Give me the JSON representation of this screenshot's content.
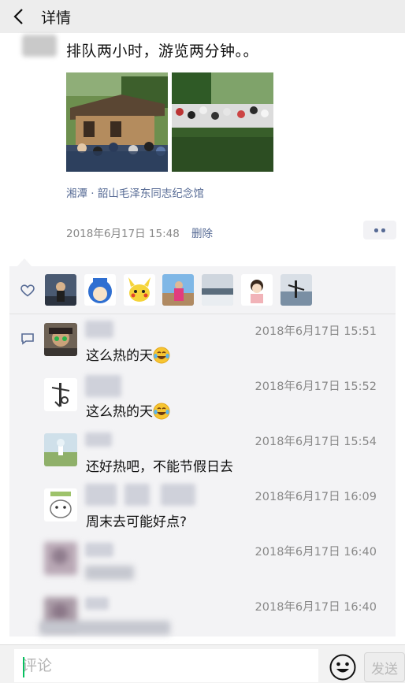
{
  "header": {
    "title": "详情"
  },
  "post": {
    "text": "排队两小时，游览两分钟。。",
    "location": "湘潭 · 韶山毛泽东同志纪念馆",
    "time": "2018年6月17日 15:48",
    "delete_label": "删除",
    "photos": [
      "photo-building-crowd",
      "photo-garden-crowd"
    ]
  },
  "likes": {
    "icon": "heart-icon",
    "avatars": [
      "avatar-person",
      "avatar-cartoon-helmet",
      "avatar-pikachu",
      "avatar-girl-pink",
      "avatar-landscape",
      "avatar-cartoon-girl",
      "avatar-sea-figure"
    ]
  },
  "comments": [
    {
      "time": "2018年6月17日 15:51",
      "text": "这么热的天",
      "emoji": "laughing-tears-emoji"
    },
    {
      "time": "2018年6月17日 15:52",
      "text": "这么热的天",
      "emoji": "laughing-tears-emoji"
    },
    {
      "time": "2018年6月17日 15:54",
      "text": "还好热吧，不能节假日去"
    },
    {
      "time": "2018年6月17日 16:09",
      "text": "周末去可能好点?"
    },
    {
      "time": "2018年6月17日 16:40",
      "text": ""
    },
    {
      "time": "2018年6月17日 16:40",
      "text": ""
    }
  ],
  "input": {
    "placeholder": "评论",
    "send_label": "发送"
  },
  "colors": {
    "link": "#576b95",
    "header_bg": "#ededed",
    "panel_bg": "#f3f3f5",
    "caret": "#07c160"
  }
}
